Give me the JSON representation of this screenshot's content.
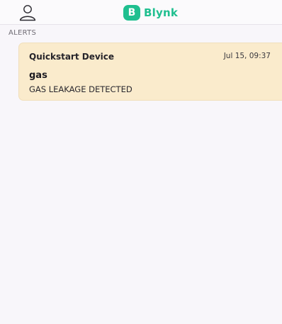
{
  "header": {
    "profile_icon": "user-outline-icon",
    "logo_letter": "B",
    "logo_text": "Blynk",
    "accent_color": "#1fbf8f"
  },
  "alerts": {
    "section_title": "ALERTS",
    "items": [
      {
        "device": "Quickstart Device",
        "timestamp": "Jul 15, 09:37",
        "event": "gas",
        "message": "GAS LEAKAGE DETECTED",
        "card_color": "#faebcc"
      }
    ]
  }
}
